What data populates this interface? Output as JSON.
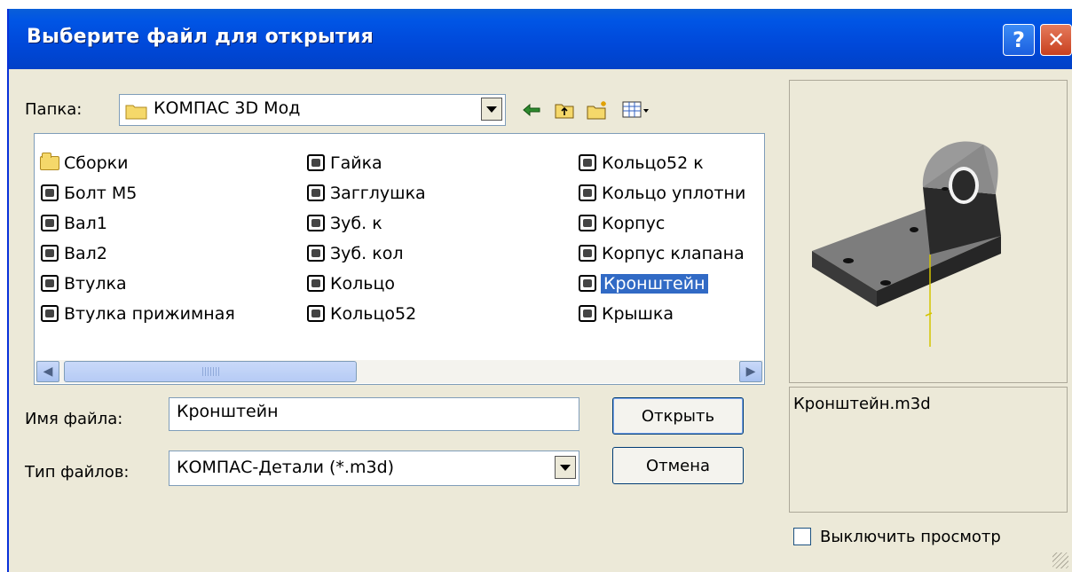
{
  "window": {
    "title": "Выберите файл для открытия",
    "help_label": "?",
    "close_label": "✕"
  },
  "folder": {
    "label": "Папка:",
    "value": "КОМПАС 3D Мод"
  },
  "toolbar": {
    "icons": [
      "back-arrow-icon",
      "up-folder-icon",
      "new-folder-icon",
      "view-menu-icon"
    ]
  },
  "files": {
    "col1": [
      {
        "name": "Сборки",
        "type": "folder"
      },
      {
        "name": "Болт М5",
        "type": "part"
      },
      {
        "name": "Вал1",
        "type": "part"
      },
      {
        "name": "Вал2",
        "type": "part"
      },
      {
        "name": "Втулка",
        "type": "part"
      },
      {
        "name": "Втулка прижимная",
        "type": "part"
      }
    ],
    "col2": [
      {
        "name": "Гайка",
        "type": "part"
      },
      {
        "name": "Загглушка",
        "type": "part"
      },
      {
        "name": "Зуб. к",
        "type": "part"
      },
      {
        "name": "Зуб. кол",
        "type": "part"
      },
      {
        "name": "Кольцо",
        "type": "part"
      },
      {
        "name": "Кольцо52",
        "type": "part"
      }
    ],
    "col3": [
      {
        "name": "Кольцо52 к",
        "type": "part"
      },
      {
        "name": "Кольцо уплотни",
        "type": "part"
      },
      {
        "name": "Корпус",
        "type": "part"
      },
      {
        "name": "Корпус клапана",
        "type": "part"
      },
      {
        "name": "Кронштейн",
        "type": "part",
        "selected": true
      },
      {
        "name": "Крышка",
        "type": "part"
      }
    ]
  },
  "filename": {
    "label": "Имя файла:",
    "value": "Кронштейн"
  },
  "filetype": {
    "label": "Тип файлов:",
    "value": "КОМПАС-Детали (*.m3d)"
  },
  "buttons": {
    "open": "Открыть",
    "cancel": "Отмена"
  },
  "preview": {
    "info": "Кронштейн.m3d",
    "disable_label": "Выключить просмотр",
    "disable_checked": false
  },
  "colors": {
    "title_bar": "#0055E5",
    "dialog_bg": "#ECE9D8",
    "selection": "#316AC5"
  }
}
